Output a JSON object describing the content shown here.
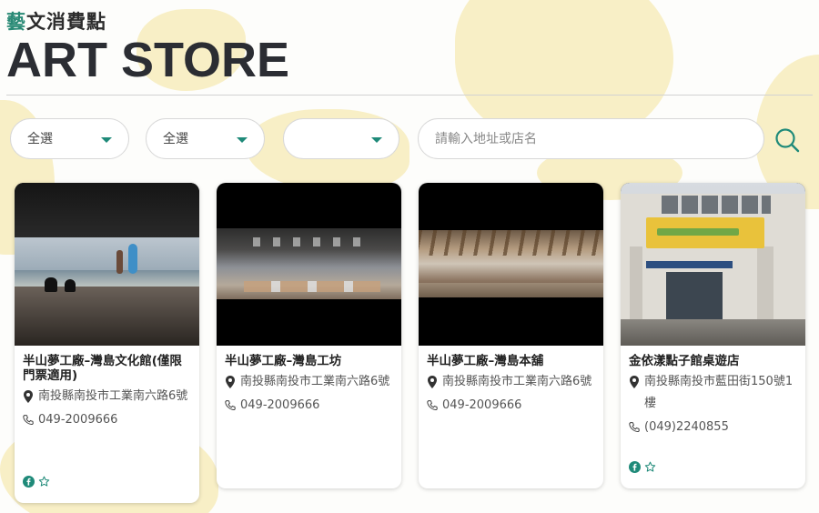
{
  "header": {
    "subtitle_first": "藝",
    "subtitle_rest": "文消費點",
    "title": "ART STORE"
  },
  "filters": {
    "select1": {
      "value": "全選"
    },
    "select2": {
      "value": "全選"
    },
    "select3": {
      "value": ""
    },
    "search": {
      "placeholder": "請輸入地址或店名",
      "value": ""
    },
    "search_icon": "search-icon"
  },
  "colors": {
    "accent": "#1f8a79",
    "subtitle_accent": "#2a8a76",
    "background_blob": "#f8efc6",
    "title": "#2b2d33"
  },
  "stores": [
    {
      "name": "半山夢工廠–灣島文化館(僅限門票適用)",
      "address": "南投縣南投市工業南六路6號",
      "phone": "049-2009666",
      "social": [
        "facebook-icon",
        "star-icon"
      ]
    },
    {
      "name": "半山夢工廠–灣島工坊",
      "address": "南投縣南投市工業南六路6號",
      "phone": "049-2009666",
      "social": []
    },
    {
      "name": "半山夢工廠–灣島本舖",
      "address": "南投縣南投市工業南六路6號",
      "phone": "049-2009666",
      "social": []
    },
    {
      "name": "金依漾點子館桌遊店",
      "address": "南投縣南投市藍田街150號1樓",
      "phone": "(049)2240855",
      "social": [
        "facebook-icon",
        "star-icon"
      ]
    }
  ]
}
